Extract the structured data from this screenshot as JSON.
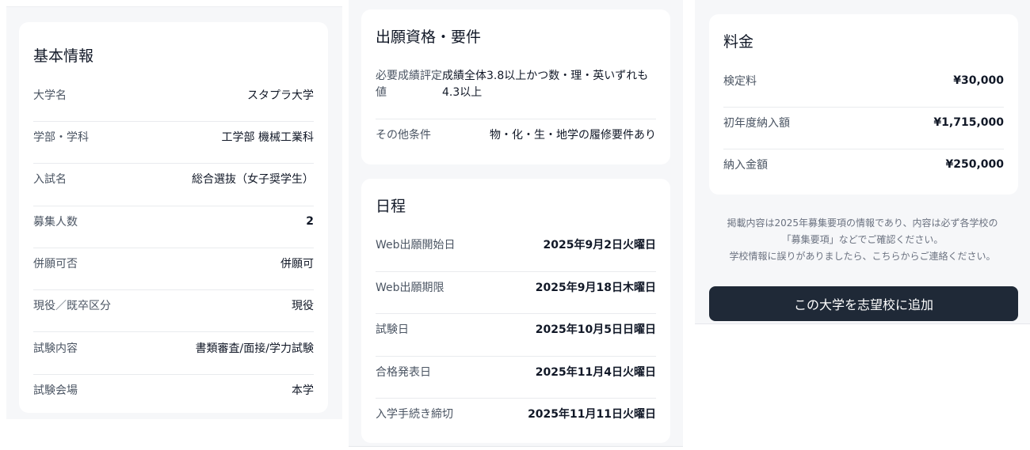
{
  "basic": {
    "title": "基本情報",
    "rows": [
      {
        "label": "大学名",
        "value": "スタプラ大学"
      },
      {
        "label": "学部・学科",
        "value": "工学部 機械工業科"
      },
      {
        "label": "入試名",
        "value": "総合選抜（女子奨学生）"
      },
      {
        "label": "募集人数",
        "value": "2"
      },
      {
        "label": "併願可否",
        "value": "併願可"
      },
      {
        "label": "現役／既卒区分",
        "value": "現役"
      },
      {
        "label": "試験内容",
        "value": "書類審査/面接/学力試験"
      },
      {
        "label": "試験会場",
        "value": "本学"
      }
    ]
  },
  "requirements": {
    "title": "出願資格・要件",
    "rows": [
      {
        "label": "必要成績評定値",
        "value": "成績全体3.8以上かつ数・理・英いずれも4.3以上"
      },
      {
        "label": "その他条件",
        "value": "物・化・生・地学の履修要件あり"
      }
    ]
  },
  "schedule": {
    "title": "日程",
    "rows": [
      {
        "label": "Web出願開始日",
        "value": "2025年9月2日火曜日"
      },
      {
        "label": "Web出願期限",
        "value": "2025年9月18日木曜日"
      },
      {
        "label": "試験日",
        "value": "2025年10月5日日曜日"
      },
      {
        "label": "合格発表日",
        "value": "2025年11月4日火曜日"
      },
      {
        "label": "入学手続き締切",
        "value": "2025年11月11日火曜日"
      }
    ]
  },
  "fees": {
    "title": "料金",
    "rows": [
      {
        "label": "検定料",
        "value": "¥30,000"
      },
      {
        "label": "初年度納入額",
        "value": "¥1,715,000"
      },
      {
        "label": "納入金額",
        "value": "¥250,000"
      }
    ]
  },
  "notice": {
    "line1": "掲載内容は2025年募集要項の情報であり、内容は必ず各学校の",
    "line2": "「募集要項」などでご確認ください。",
    "line3": "学校情報に誤りがありましたら、こちらからご連絡ください。"
  },
  "cta": {
    "label": "この大学を志望校に追加"
  }
}
